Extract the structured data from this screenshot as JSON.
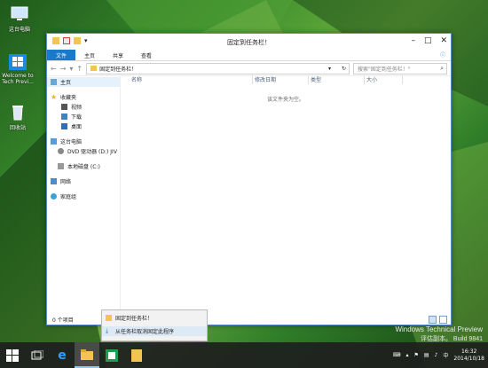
{
  "desktop": {
    "icons": [
      {
        "label": "这台电脑"
      },
      {
        "label": "Welcome to Tech Previ..."
      },
      {
        "label": "回收站"
      }
    ]
  },
  "window": {
    "title": "固定到任务栏！",
    "ribbon_tabs": [
      "文件",
      "主页",
      "共享",
      "查看"
    ],
    "address": "固定到任务栏！",
    "search_placeholder": "搜索\"固定到任务栏！\"",
    "nav_items": [
      {
        "label": "主页"
      },
      {
        "label": "收藏夹"
      },
      {
        "label": "视频"
      },
      {
        "label": "下载"
      },
      {
        "label": "桌面"
      },
      {
        "label": "这台电脑"
      },
      {
        "label": "DVD 驱动器 (D:) JIV"
      },
      {
        "label": "本地磁盘 (C:)"
      },
      {
        "label": "网络"
      },
      {
        "label": "家庭组"
      }
    ],
    "columns": [
      "名称",
      "修改日期",
      "类型",
      "大小"
    ],
    "empty_text": "该文件夹为空。",
    "status_text": "0 个项目"
  },
  "jumplist": {
    "items": [
      "固定到任务栏！",
      "从任务栏取消固定此程序"
    ]
  },
  "watermark": {
    "line1": "Windows Technical Preview",
    "line2": "评估副本。 Build 9841"
  },
  "taskbar": {
    "time": "16:32",
    "date": "2014/10/18"
  }
}
